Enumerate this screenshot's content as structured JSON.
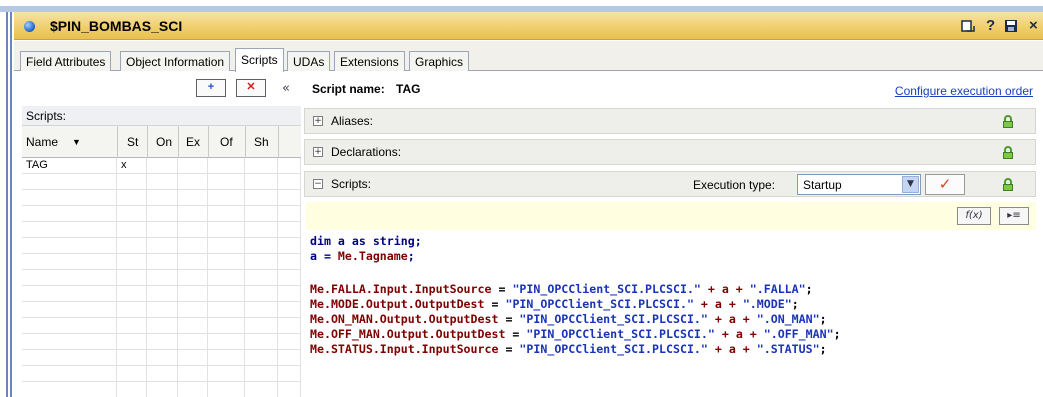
{
  "window": {
    "title": "$PIN_BOMBAS_SCI"
  },
  "title_icons": [
    "document-icon",
    "help-icon",
    "save-icon",
    "close-icon"
  ],
  "title_glyphs": {
    "help": "?",
    "close": "×"
  },
  "tabs": [
    {
      "label": "Field Attributes",
      "active": false
    },
    {
      "label": "Object Information",
      "active": false
    },
    {
      "label": "Scripts",
      "active": true
    },
    {
      "label": "UDAs",
      "active": false
    },
    {
      "label": "Extensions",
      "active": false
    },
    {
      "label": "Graphics",
      "active": false
    }
  ],
  "left": {
    "add_glyph": "+",
    "remove_glyph": "✕",
    "collapse_glyph": "«",
    "scripts_label": "Scripts:",
    "columns": [
      "Name",
      "St",
      "On",
      "Ex",
      "Of",
      "Sh"
    ],
    "sort_glyph": "▼",
    "rows": [
      {
        "name": "TAG",
        "st": "x",
        "on": "",
        "ex": "",
        "of": "",
        "sh": ""
      }
    ]
  },
  "right": {
    "script_name_label": "Script name:",
    "script_name": "TAG",
    "config_link": "Configure execution order",
    "sections": {
      "aliases": "Aliases:",
      "declarations": "Declarations:",
      "scripts": "Scripts:"
    },
    "expand_glyph": "+",
    "collapse_glyph": "−",
    "execution_type_label": "Execution type:",
    "execution_type_value": "Startup",
    "check_glyph": "✓",
    "tb_fx": "f(x)",
    "tb_list": "▸≡"
  },
  "code": {
    "l1": {
      "kw": "dim a as string;"
    },
    "l2": {
      "a": "a = ",
      "obj": "Me.Tagname",
      "semi": ";"
    },
    "lines": [
      {
        "lhs": "Me.FALLA.Input.InputSource",
        "eq": " = ",
        "s1": "\"PIN_OPCClient_SCI.PLCSCI.\"",
        "mid": " + a + ",
        "s2": "\".FALLA\"",
        "end": ";"
      },
      {
        "lhs": "Me.MODE.Output.OutputDest",
        "eq": " = ",
        "s1": "\"PIN_OPCClient_SCI.PLCSCI.\"",
        "mid": " + a + ",
        "s2": "\".MODE\"",
        "end": ";"
      },
      {
        "lhs": "Me.ON_MAN.Output.OutputDest",
        "eq": " = ",
        "s1": "\"PIN_OPCClient_SCI.PLCSCI.\"",
        "mid": " + a + ",
        "s2": "\".ON_MAN\"",
        "end": ";"
      },
      {
        "lhs": "Me.OFF_MAN.Output.OutputDest",
        "eq": " = ",
        "s1": "\"PIN_OPCClient_SCI.PLCSCI.\"",
        "mid": " + a + ",
        "s2": "\".OFF_MAN\"",
        "end": ";"
      },
      {
        "lhs": "Me.STATUS.Input.InputSource",
        "eq": " = ",
        "s1": "\"PIN_OPCClient_SCI.PLCSCI.\"",
        "mid": " + a + ",
        "s2": "\".STATUS\"",
        "end": ";"
      }
    ]
  },
  "colors": {
    "title_bar": "#f0cf6e",
    "link": "#1a3fbf",
    "keyword": "#00007f",
    "object": "#7f0000",
    "string": "#1a33b8",
    "lock": "#7cc64a",
    "check": "#d8441b",
    "editor_toolbar_bg": "#fffee0"
  }
}
